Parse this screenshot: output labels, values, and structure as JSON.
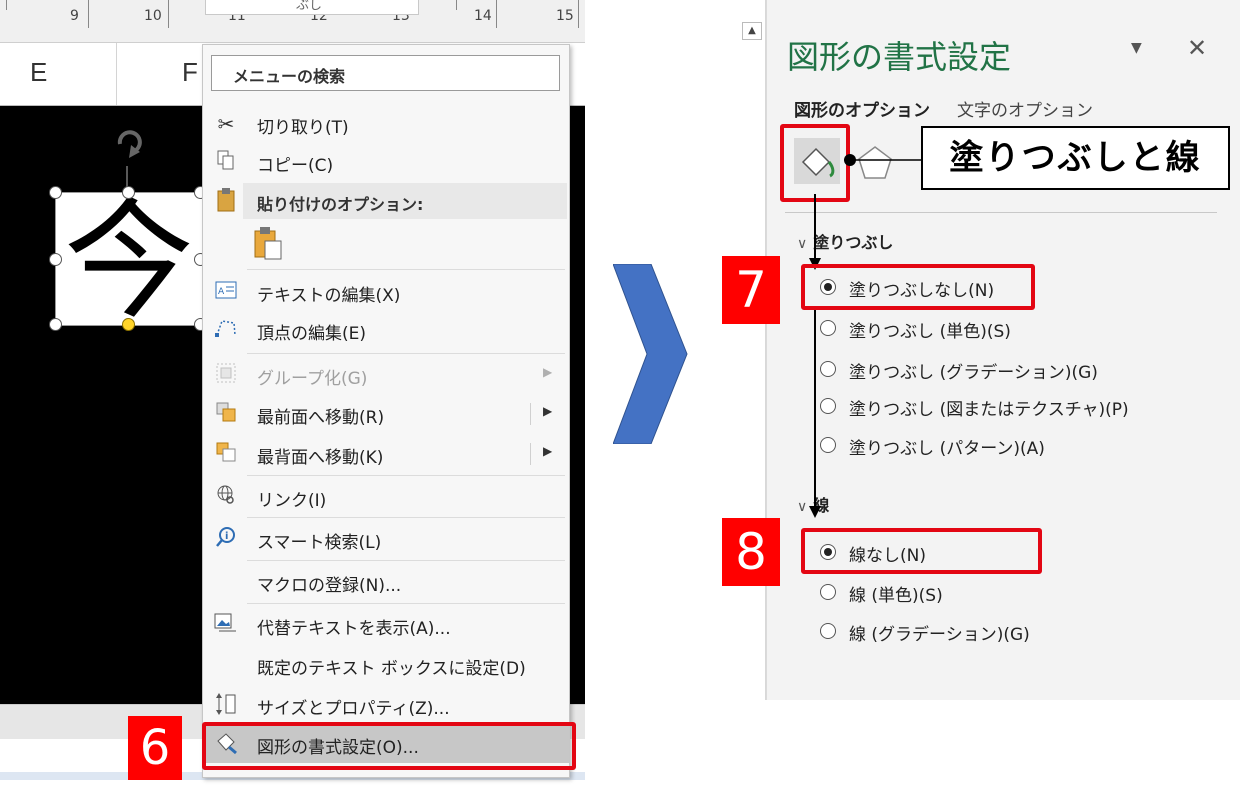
{
  "ruler": {
    "numbers": [
      "9",
      "10",
      "11",
      "12",
      "13",
      "14",
      "15"
    ]
  },
  "columns": {
    "e": "E",
    "f": "F"
  },
  "shape": {
    "text": "今"
  },
  "top_menu_text": "ぶし",
  "context_menu": {
    "search_placeholder": "メニューの検索",
    "items": {
      "cut": "切り取り(T)",
      "copy": "コピー(C)",
      "paste_options": "貼り付けのオプション:",
      "edit_text": "テキストの編集(X)",
      "edit_points": "頂点の編集(E)",
      "group": "グループ化(G)",
      "bring_front": "最前面へ移動(R)",
      "send_back": "最背面へ移動(K)",
      "link": "リンク(I)",
      "smart_lookup": "スマート検索(L)",
      "assign_macro": "マクロの登録(N)...",
      "alt_text": "代替テキストを表示(A)...",
      "set_default_textbox": "既定のテキスト ボックスに設定(D)",
      "size_properties": "サイズとプロパティ(Z)...",
      "format_shape": "図形の書式設定(O)..."
    }
  },
  "format_pane": {
    "title": "図形の書式設定",
    "dropdown_glyph": "▼",
    "close_glyph": "✕",
    "tabs": {
      "shape_options": "図形のオプション",
      "text_options": "文字のオプション"
    },
    "fill_section": "塗りつぶし",
    "fill_options": [
      "塗りつぶしなし(N)",
      "塗りつぶし (単色)(S)",
      "塗りつぶし (グラデーション)(G)",
      "塗りつぶし (図またはテクスチャ)(P)",
      "塗りつぶし (パターン)(A)"
    ],
    "line_section": "線",
    "line_options": [
      "線なし(N)",
      "線 (単色)(S)",
      "線 (グラデーション)(G)"
    ]
  },
  "annotations": {
    "step6": "6",
    "step7": "7",
    "step8": "8",
    "callout": "塗りつぶしと線"
  },
  "colors": {
    "accent_red": "#e30613",
    "title_green": "#217346",
    "arrow_blue": "#4472c4"
  }
}
